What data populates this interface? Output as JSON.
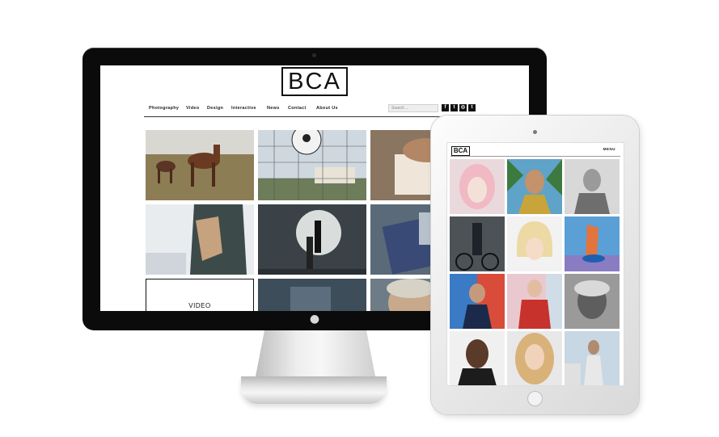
{
  "site": {
    "logo": "BCA",
    "nav": [
      "Photography",
      "Video",
      "Design",
      "Interactive",
      "News",
      "Contact",
      "About Us"
    ],
    "search_placeholder": "Search ...",
    "social_icons": [
      "facebook-icon",
      "twitter-icon",
      "instagram-icon",
      "tumblr-icon"
    ],
    "social_glyphs": [
      "f",
      "t",
      "◎",
      "t"
    ],
    "video_tile_label": "VIDEO"
  },
  "ipad_site": {
    "logo": "BCA",
    "menu_label": "MENU"
  },
  "desktop_tiles": [
    {
      "name": "tile-horses",
      "subject": "horses"
    },
    {
      "name": "tile-soccer",
      "subject": "soccer ball"
    },
    {
      "name": "tile-hands",
      "subject": "hands"
    },
    {
      "name": "tile-torso",
      "subject": "torso"
    },
    {
      "name": "tile-studio",
      "subject": "studio"
    },
    {
      "name": "tile-abstract",
      "subject": "abstract"
    },
    {
      "name": "tile-video",
      "subject": "video"
    },
    {
      "name": "tile-dark",
      "subject": "dark"
    },
    {
      "name": "tile-portrait-man",
      "subject": "portrait"
    }
  ],
  "ipad_tiles": [
    {
      "name": "itile-pink-hair"
    },
    {
      "name": "itile-man-palms"
    },
    {
      "name": "itile-bw-man"
    },
    {
      "name": "itile-bicycle"
    },
    {
      "name": "itile-bob-hair"
    },
    {
      "name": "itile-blue-sculpture"
    },
    {
      "name": "itile-suit-colour"
    },
    {
      "name": "itile-red-shirt"
    },
    {
      "name": "itile-bw-old-man"
    },
    {
      "name": "itile-smiling-man"
    },
    {
      "name": "itile-blonde-woman"
    },
    {
      "name": "itile-sky-man"
    }
  ]
}
